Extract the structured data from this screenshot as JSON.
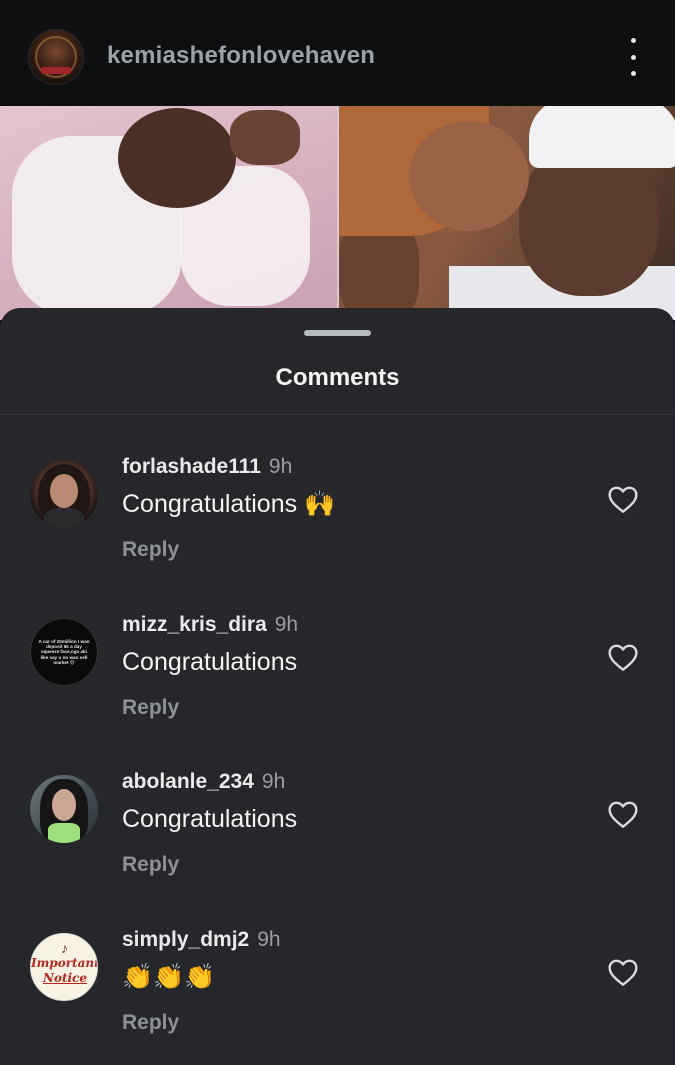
{
  "post": {
    "username": "kemiashefonlovehaven",
    "menu_icon": "more-vertical-icon"
  },
  "sheet": {
    "title": "Comments"
  },
  "comments": [
    {
      "username": "forlashade111",
      "time": "9h",
      "text": "Congratulations 🙌",
      "reply": "Reply",
      "like_icon": "heart-outline-icon"
    },
    {
      "username": "mizz_kris_dira",
      "time": "9h",
      "text": "Congratulations",
      "reply": "Reply",
      "like_icon": "heart-outline-icon"
    },
    {
      "username": "abolanle_234",
      "time": "9h",
      "text": "Congratulations",
      "reply": "Reply",
      "like_icon": "heart-outline-icon"
    },
    {
      "username": "simply_dmj2",
      "time": "9h",
      "text": "👏👏👏",
      "reply": "Reply",
      "like_icon": "heart-outline-icon"
    }
  ],
  "avatar_texts": {
    "mizz_kris_dira": "A car of 20million I wan deposit 5k a day squeeze face,oga abi like say u no wan sell market 😞",
    "simply_dmj2_line1": "Important",
    "simply_dmj2_line2": "Notice"
  },
  "colors": {
    "sheet_bg": "#25272b",
    "header_bg": "#0e0f11",
    "username_header": "#9ba1a8",
    "reply": "#8d9197"
  }
}
